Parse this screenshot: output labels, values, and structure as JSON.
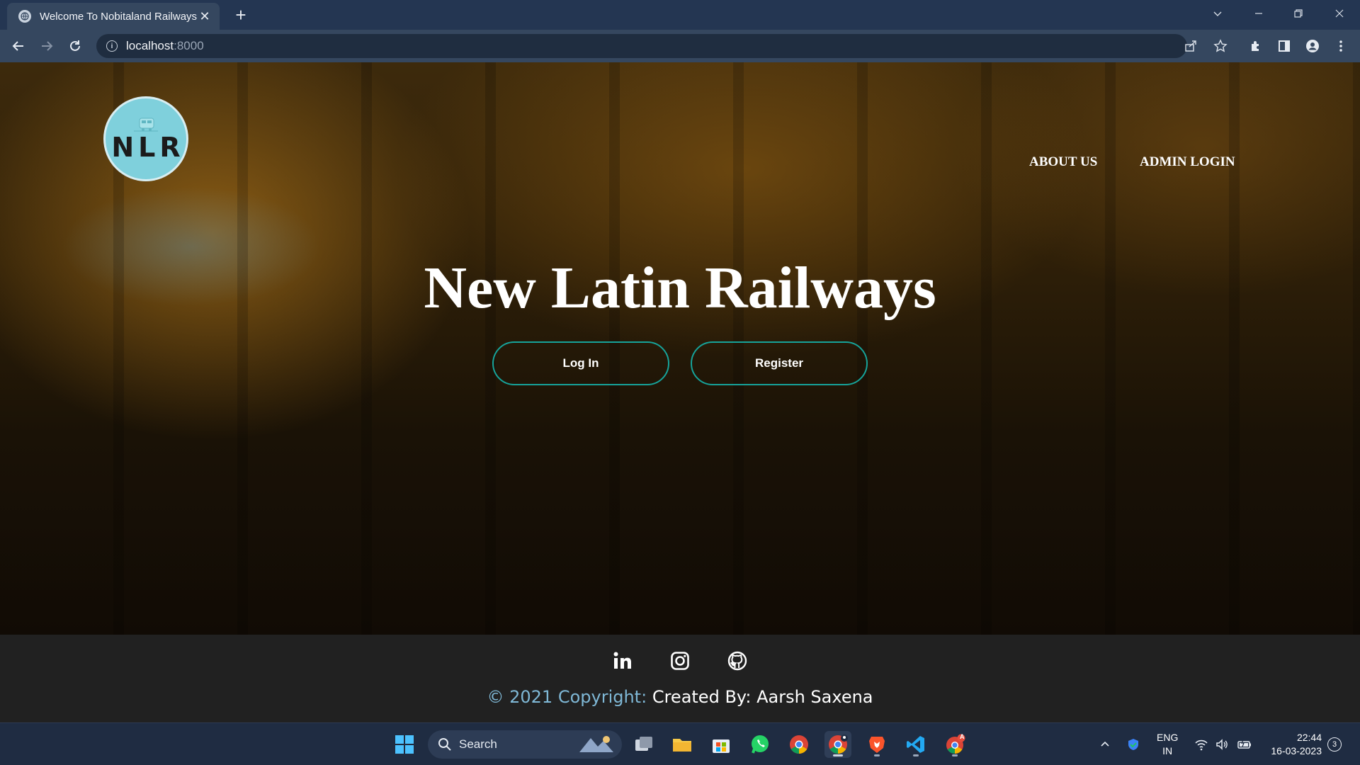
{
  "browser": {
    "tab_title": "Welcome To Nobitaland Railways",
    "url_host": "localhost",
    "url_port": ":8000"
  },
  "site": {
    "logo_text": "NLR",
    "nav": {
      "about": "ABOUT US",
      "admin": "ADMIN LOGIN"
    },
    "headline": "New Latin Railways",
    "buttons": {
      "login": "Log In",
      "register": "Register"
    }
  },
  "footer": {
    "social": [
      "linkedin-icon",
      "instagram-icon",
      "github-icon"
    ],
    "copyright_prefix": "© 2021 Copyright:",
    "copyright_author": "Created By: Aarsh Saxena"
  },
  "taskbar": {
    "search_label": "Search",
    "lang_top": "ENG",
    "lang_bottom": "IN",
    "time": "22:44",
    "date": "16-03-2023",
    "notification_count": "3",
    "chrome_badge": "A"
  },
  "colors": {
    "accent_button_border": "#16a39a",
    "logo_bg": "#7fd0dc",
    "copyright_prefix": "#7fb8d6"
  }
}
